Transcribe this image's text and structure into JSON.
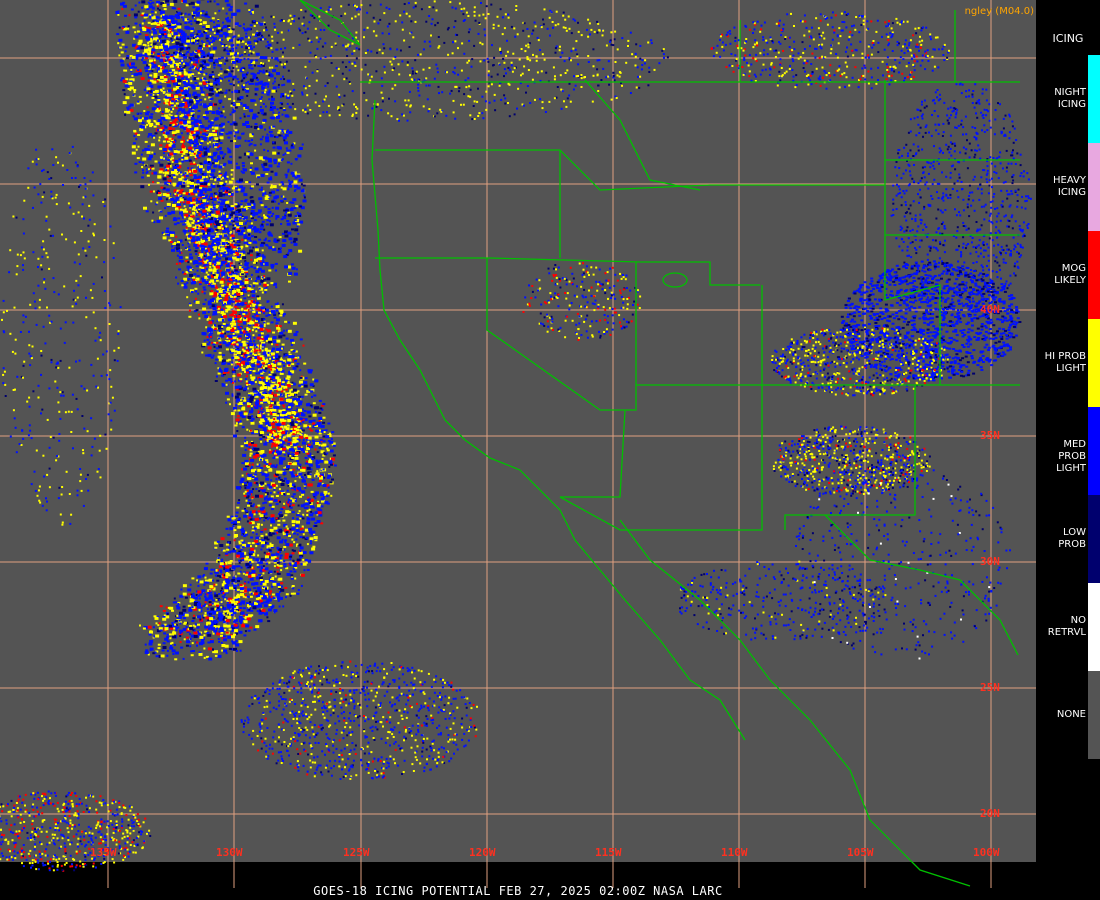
{
  "credit": "ngley (M04.0)",
  "footer": "GOES-18  ICING POTENTIAL   FEB 27, 2025 02:00Z   NASA LARC",
  "legend": {
    "title": "ICING",
    "items": [
      {
        "label": "NIGHT\nICING",
        "color": "#00ffff"
      },
      {
        "label": "HEAVY\nICING",
        "color": "#e8a8e0"
      },
      {
        "label": "MOG\nLIKELY",
        "color": "#ff0000"
      },
      {
        "label": "HI PROB\nLIGHT",
        "color": "#ffff00"
      },
      {
        "label": "MED PROB\nLIGHT",
        "color": "#0000ff"
      },
      {
        "label": "LOW\nPROB",
        "color": "#00006e"
      },
      {
        "label": "NO\nRETRVL",
        "color": "#ffffff"
      },
      {
        "label": "NONE",
        "color": "#545454"
      }
    ]
  },
  "grid": {
    "lat_labels": [
      "40N",
      "35N",
      "30N",
      "25N",
      "20N"
    ],
    "lon_labels": [
      "135W",
      "130W",
      "125W",
      "120W",
      "115W",
      "110W",
      "105W",
      "100W"
    ]
  },
  "colors": {
    "background": "#545454",
    "grid": "#e0a080",
    "borders": "#00c000",
    "gridlabel": "#ff3020"
  }
}
